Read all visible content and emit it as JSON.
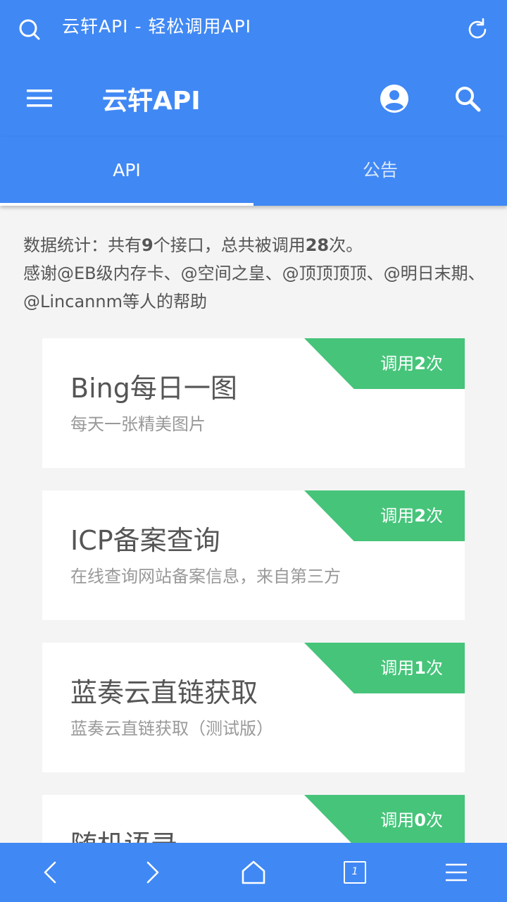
{
  "browser": {
    "title": "云轩API - 轻松调用API",
    "search_icon": "search-icon",
    "refresh_icon": "refresh-icon"
  },
  "appbar": {
    "title": "云轩API",
    "menu_icon": "hamburger-menu-icon",
    "account_icon": "account-circle-icon",
    "search_icon": "search-icon"
  },
  "tabs": [
    {
      "label": "API",
      "active": true
    },
    {
      "label": "公告",
      "active": false
    }
  ],
  "stats": {
    "prefix": "数据统计：共有",
    "api_count": "9",
    "middle": "个接口，总共被调用",
    "total_calls": "28",
    "suffix": "次。",
    "thanks": "感谢@EB级内存卡、@空间之皇、@顶顶顶顶、@明日末期、@Lincannm等人的帮助"
  },
  "cards": [
    {
      "title": "Bing每日一图",
      "desc": "每天一张精美图片",
      "call_prefix": "调用",
      "calls": "2",
      "call_suffix": "次"
    },
    {
      "title": "ICP备案查询",
      "desc": "在线查询网站备案信息，来自第三方",
      "call_prefix": "调用",
      "calls": "2",
      "call_suffix": "次"
    },
    {
      "title": "蓝奏云直链获取",
      "desc": "蓝奏云直链获取（测试版）",
      "call_prefix": "调用",
      "calls": "1",
      "call_suffix": "次"
    },
    {
      "title": "随机语录",
      "desc": "",
      "call_prefix": "调用",
      "calls": "0",
      "call_suffix": "次"
    }
  ],
  "colors": {
    "primary": "#4088f4",
    "ribbon": "#46c47a"
  },
  "bottom_bar": {
    "icons": [
      "back-icon",
      "forward-icon",
      "home-icon",
      "tabs-icon",
      "menu-icon"
    ],
    "tab_count": "1"
  }
}
